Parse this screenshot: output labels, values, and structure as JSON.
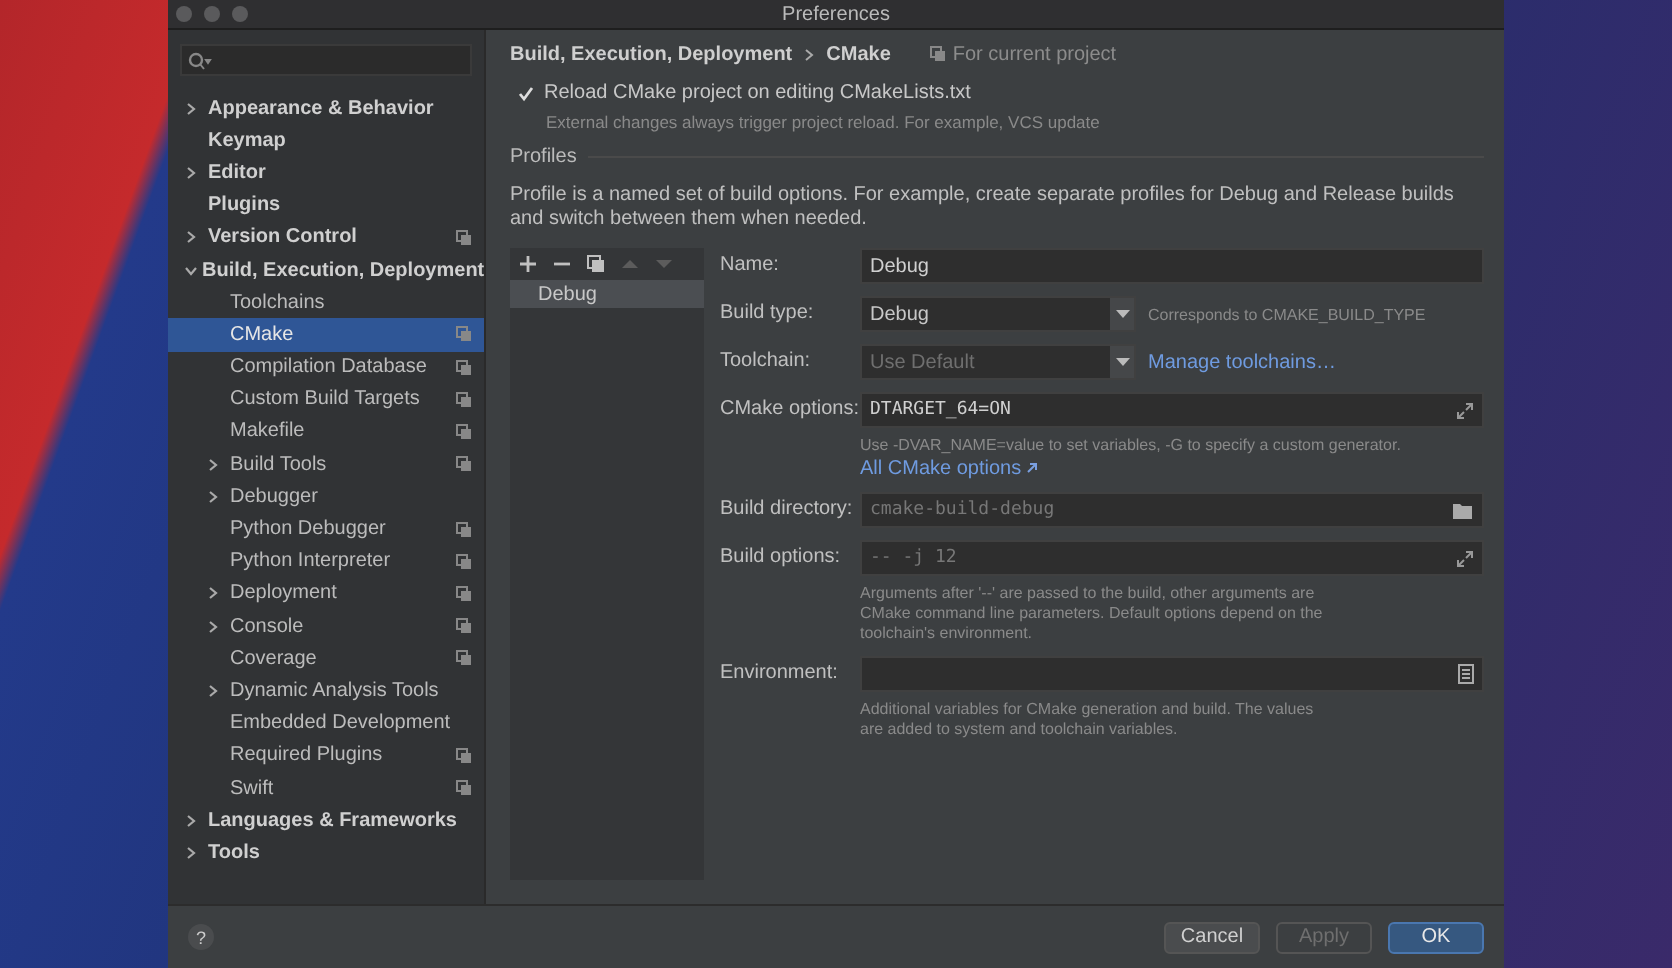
{
  "window": {
    "title": "Preferences"
  },
  "sidebar": {
    "items": [
      {
        "label": "Appearance & Behavior",
        "expanded": false,
        "selected": false
      },
      {
        "label": "Keymap",
        "selected": false
      },
      {
        "label": "Editor",
        "expanded": false,
        "selected": false
      },
      {
        "label": "Plugins",
        "selected": false
      },
      {
        "label": "Version Control",
        "expanded": false,
        "selected": false,
        "project_scope": true
      },
      {
        "label": "Build, Execution, Deployment",
        "expanded": true,
        "selected": false,
        "children": [
          {
            "label": "Toolchains",
            "selected": false
          },
          {
            "label": "CMake",
            "selected": true,
            "project_scope": true
          },
          {
            "label": "Compilation Database",
            "selected": false,
            "project_scope": true
          },
          {
            "label": "Custom Build Targets",
            "selected": false,
            "project_scope": true
          },
          {
            "label": "Makefile",
            "selected": false,
            "project_scope": true
          },
          {
            "label": "Build Tools",
            "expanded": false,
            "selected": false,
            "project_scope": true
          },
          {
            "label": "Debugger",
            "expanded": false,
            "selected": false
          },
          {
            "label": "Python Debugger",
            "selected": false,
            "project_scope": true
          },
          {
            "label": "Python Interpreter",
            "selected": false,
            "project_scope": true
          },
          {
            "label": "Deployment",
            "expanded": false,
            "selected": false,
            "project_scope": true
          },
          {
            "label": "Console",
            "expanded": false,
            "selected": false,
            "project_scope": true
          },
          {
            "label": "Coverage",
            "selected": false,
            "project_scope": true
          },
          {
            "label": "Dynamic Analysis Tools",
            "expanded": false,
            "selected": false
          },
          {
            "label": "Embedded Development",
            "selected": false
          },
          {
            "label": "Required Plugins",
            "selected": false,
            "project_scope": true
          },
          {
            "label": "Swift",
            "selected": false,
            "project_scope": true
          }
        ]
      },
      {
        "label": "Languages & Frameworks",
        "expanded": false,
        "selected": false
      },
      {
        "label": "Tools",
        "expanded": false,
        "selected": false
      }
    ]
  },
  "breadcrumb": {
    "parts": [
      "Build, Execution, Deployment",
      "CMake"
    ],
    "scope": "For current project"
  },
  "reload_option": {
    "label": "Reload CMake project on editing CMakeLists.txt",
    "checked": true,
    "hint": "External changes always trigger project reload. For example, VCS update"
  },
  "profiles": {
    "title": "Profiles",
    "description": "Profile is a named set of build options. For example, create separate profiles for Debug and Release builds and switch between them when needed.",
    "toolbar": [
      {
        "kind": "add",
        "disabled": false
      },
      {
        "kind": "remove",
        "disabled": false
      },
      {
        "kind": "copy",
        "disabled": false
      },
      {
        "kind": "up",
        "disabled": true
      },
      {
        "kind": "down",
        "disabled": true
      }
    ],
    "list": [
      {
        "label": "Debug",
        "selected": true
      }
    ]
  },
  "form": {
    "rows": [
      {
        "kind": "text",
        "label": "Name:",
        "value": "Debug"
      },
      {
        "kind": "select",
        "label": "Build type:",
        "value": "Debug",
        "disabled": false,
        "note": "Corresponds to CMAKE_BUILD_TYPE"
      },
      {
        "kind": "select",
        "label": "Toolchain:",
        "value": "Use Default",
        "disabled": true,
        "link": "Manage toolchains…"
      },
      {
        "kind": "expand",
        "label": "CMake options:",
        "value": "DTARGET_64=ON",
        "hint": "Use -DVAR_NAME=value to set variables, -G to specify a custom generator.",
        "link": "All CMake options"
      },
      {
        "kind": "folder",
        "label": "Build directory:",
        "placeholder": "cmake-build-debug"
      },
      {
        "kind": "expand",
        "label": "Build options:",
        "placeholder": "-- -j 12",
        "hint": "Arguments after '--' are passed to the build, other arguments are CMake command line parameters. Default options depend on the toolchain's environment."
      },
      {
        "kind": "env",
        "label": "Environment:",
        "hint": "Additional variables for CMake generation and build. The values are added to system and toolchain variables."
      }
    ]
  },
  "help_button": {
    "label": "?"
  },
  "buttons": [
    {
      "label": "Cancel",
      "kind": "default"
    },
    {
      "label": "Apply",
      "kind": "disabled"
    },
    {
      "label": "OK",
      "kind": "primary"
    }
  ]
}
